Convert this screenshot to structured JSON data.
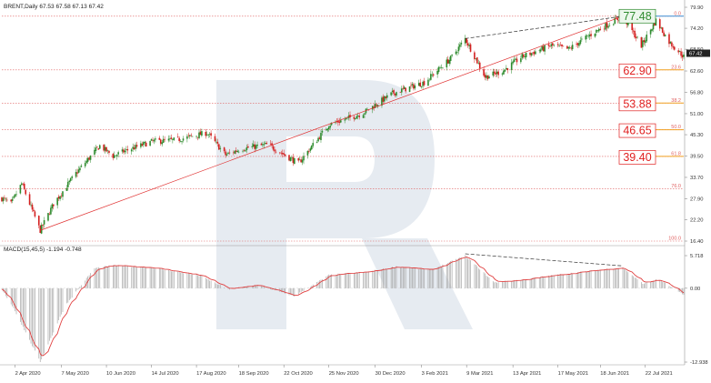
{
  "price_panel": {
    "header": "BRENT,Daily  67.53 67.58 67.13 67.42",
    "y_ticks": [
      "79.90",
      "74.20",
      "68.50",
      "62.60",
      "56.80",
      "51.00",
      "45.30",
      "39.50",
      "33.70",
      "27.90",
      "22.20",
      "16.40"
    ],
    "current_price_label": "67.42"
  },
  "macd_panel": {
    "header": "MACD(15,45,5) -1.194 -0.748",
    "y_ticks": [
      "5.718",
      "0.00",
      "-12.938"
    ]
  },
  "x_ticks": [
    "2 Apr 2020",
    "7 May 2020",
    "10 Jun 2020",
    "14 Jul 2020",
    "17 Aug 2020",
    "18 Sep 2020",
    "22 Oct 2020",
    "25 Nov 2020",
    "30 Dec 2020",
    "3 Feb 2021",
    "9 Mar 2021",
    "13 Apr 2021",
    "17 May 2021",
    "18 Jun 2021",
    "22 Jul 2021"
  ],
  "fibo_levels": [
    {
      "pct": "0.0",
      "price": 77.48,
      "label": "77.48"
    },
    {
      "pct": "23.6",
      "price": 62.9,
      "label": "62.90"
    },
    {
      "pct": "38.2",
      "price": 53.88,
      "label": "53.88"
    },
    {
      "pct": "50.0",
      "price": 46.65,
      "label": "46.65"
    },
    {
      "pct": "61.8",
      "price": 39.4,
      "label": "39.40"
    },
    {
      "pct": "76.0",
      "price": 30.6,
      "label": ""
    },
    {
      "pct": "100.0",
      "price": 16.4,
      "label": ""
    }
  ],
  "colors": {
    "bull": "#2e8b2e",
    "bear": "#d42020",
    "fibo_line": "#e06060",
    "fibo_target": "#f0a020",
    "highlight_green": "#2e8b2e",
    "highlight_red": "#e02020",
    "macd_hist": "#a8a8a8",
    "macd_signal": "#e04040",
    "watermark": "#e6ebf1"
  },
  "chart_data": [
    {
      "type": "candlestick",
      "title": "BRENT,Daily",
      "ohlc_last": {
        "open": 67.53,
        "high": 67.58,
        "low": 67.13,
        "close": 67.42
      },
      "ylim": [
        16.4,
        79.9
      ],
      "x_range": [
        "2020-03-23",
        "2021-08-20"
      ],
      "grid": false,
      "anchors": [
        {
          "date": "2020-03-23",
          "close": 28.0
        },
        {
          "date": "2020-03-30",
          "close": 26.5
        },
        {
          "date": "2020-04-07",
          "close": 32.0
        },
        {
          "date": "2020-04-21",
          "close": 19.3
        },
        {
          "date": "2020-05-01",
          "close": 26.5
        },
        {
          "date": "2020-05-18",
          "close": 34.8
        },
        {
          "date": "2020-06-05",
          "close": 42.3
        },
        {
          "date": "2020-06-15",
          "close": 39.5
        },
        {
          "date": "2020-06-25",
          "close": 41.0
        },
        {
          "date": "2020-07-15",
          "close": 43.5
        },
        {
          "date": "2020-08-01",
          "close": 43.8
        },
        {
          "date": "2020-08-25",
          "close": 45.8
        },
        {
          "date": "2020-09-08",
          "close": 39.8
        },
        {
          "date": "2020-09-20",
          "close": 41.5
        },
        {
          "date": "2020-10-10",
          "close": 42.6
        },
        {
          "date": "2020-11-02",
          "close": 37.5
        },
        {
          "date": "2020-11-25",
          "close": 48.0
        },
        {
          "date": "2020-12-20",
          "close": 51.0
        },
        {
          "date": "2021-01-12",
          "close": 56.5
        },
        {
          "date": "2021-02-05",
          "close": 59.5
        },
        {
          "date": "2021-02-25",
          "close": 66.0
        },
        {
          "date": "2021-03-08",
          "close": 71.4
        },
        {
          "date": "2021-03-23",
          "close": 61.0
        },
        {
          "date": "2021-04-05",
          "close": 62.5
        },
        {
          "date": "2021-04-20",
          "close": 66.5
        },
        {
          "date": "2021-05-12",
          "close": 69.5
        },
        {
          "date": "2021-05-25",
          "close": 68.5
        },
        {
          "date": "2021-06-15",
          "close": 73.5
        },
        {
          "date": "2021-07-05",
          "close": 77.48
        },
        {
          "date": "2021-07-19",
          "close": 69.5
        },
        {
          "date": "2021-07-30",
          "close": 76.3
        },
        {
          "date": "2021-08-09",
          "close": 70.5
        },
        {
          "date": "2021-08-20",
          "close": 66.5
        }
      ],
      "trend_lines": [
        {
          "style": "solid",
          "color": "red",
          "from": {
            "date": "2020-04-21",
            "value": 19.3
          },
          "to": {
            "date": "2021-07-05",
            "value": 77.48
          }
        },
        {
          "style": "dashed",
          "color": "black",
          "from": {
            "date": "2021-03-08",
            "value": 71.4
          },
          "to": {
            "date": "2021-07-05",
            "value": 77.48
          }
        }
      ]
    },
    {
      "type": "bar",
      "title": "MACD(15,45,5)",
      "series": [
        {
          "name": "MACD",
          "last": -1.194
        },
        {
          "name": "Signal",
          "last": -0.748
        }
      ],
      "ylim": [
        -12.938,
        5.718
      ],
      "anchors": [
        {
          "date": "2020-03-23",
          "value": -0.2
        },
        {
          "date": "2020-04-01",
          "value": -3.5
        },
        {
          "date": "2020-04-21",
          "value": -12.9
        },
        {
          "date": "2020-05-10",
          "value": -3.0
        },
        {
          "date": "2020-06-01",
          "value": 3.5
        },
        {
          "date": "2020-06-15",
          "value": 4.0
        },
        {
          "date": "2020-07-15",
          "value": 3.6
        },
        {
          "date": "2020-08-20",
          "value": 2.2
        },
        {
          "date": "2020-09-10",
          "value": -0.2
        },
        {
          "date": "2020-10-01",
          "value": 0.6
        },
        {
          "date": "2020-10-30",
          "value": -1.4
        },
        {
          "date": "2020-11-25",
          "value": 2.3
        },
        {
          "date": "2020-12-25",
          "value": 2.9
        },
        {
          "date": "2021-01-15",
          "value": 3.8
        },
        {
          "date": "2021-02-10",
          "value": 3.2
        },
        {
          "date": "2021-03-08",
          "value": 5.718
        },
        {
          "date": "2021-03-30",
          "value": 1.0
        },
        {
          "date": "2021-04-20",
          "value": 1.5
        },
        {
          "date": "2021-05-15",
          "value": 2.3
        },
        {
          "date": "2021-06-20",
          "value": 3.3
        },
        {
          "date": "2021-07-05",
          "value": 3.6
        },
        {
          "date": "2021-07-20",
          "value": 0.8
        },
        {
          "date": "2021-08-01",
          "value": 1.6
        },
        {
          "date": "2021-08-20",
          "value": -1.194
        }
      ],
      "trend_lines": [
        {
          "style": "dashed",
          "color": "black",
          "from": {
            "date": "2021-03-08",
            "value": 5.718
          },
          "to": {
            "date": "2021-07-05",
            "value": 3.6
          }
        }
      ]
    }
  ]
}
